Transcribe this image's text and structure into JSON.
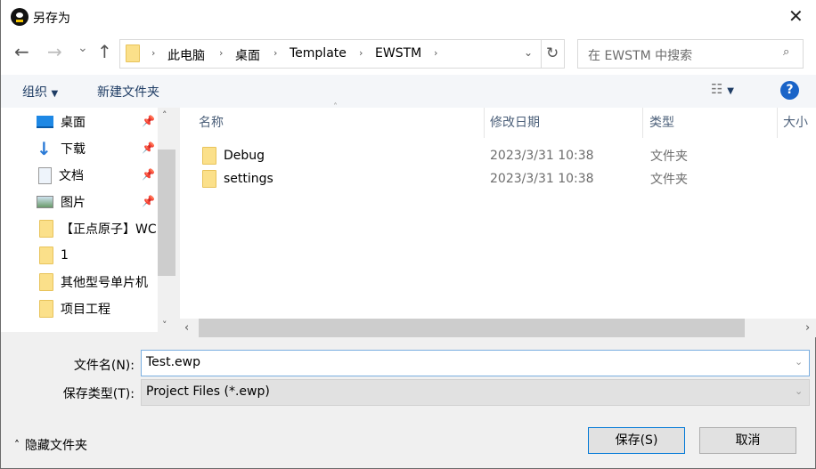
{
  "window": {
    "title": "另存为"
  },
  "nav": {
    "back": "←",
    "forward": "→",
    "recent": "⌄",
    "up": "↑",
    "breadcrumb": [
      "此电脑",
      "桌面",
      "Template",
      "EWSTM"
    ],
    "refresh": "↻",
    "search_placeholder": "在 EWSTM 中搜索"
  },
  "toolbar": {
    "organize": "组织",
    "new_folder": "新建文件夹"
  },
  "sidebar": {
    "items": [
      {
        "label": "桌面",
        "icon": "desktop-icon",
        "pinned": true
      },
      {
        "label": "下载",
        "icon": "download-icon",
        "pinned": true
      },
      {
        "label": "文档",
        "icon": "document-icon",
        "pinned": true
      },
      {
        "label": "图片",
        "icon": "pictures-icon",
        "pinned": true
      },
      {
        "label": "【正点原子】WC",
        "icon": "folder-icon"
      },
      {
        "label": "1",
        "icon": "folder-icon"
      },
      {
        "label": "其他型号单片机",
        "icon": "folder-icon"
      },
      {
        "label": "项目工程",
        "icon": "folder-icon"
      }
    ]
  },
  "list": {
    "columns": [
      "名称",
      "修改日期",
      "类型",
      "大小"
    ],
    "rows": [
      {
        "name": "Debug",
        "date": "2023/3/31 10:38",
        "type": "文件夹"
      },
      {
        "name": "settings",
        "date": "2023/3/31 10:38",
        "type": "文件夹"
      }
    ]
  },
  "form": {
    "filename_label": "文件名(N):",
    "filename_value": "Test.ewp",
    "filetype_label": "保存类型(T):",
    "filetype_value": "Project Files (*.ewp)"
  },
  "footer": {
    "hide_folders": "隐藏文件夹",
    "save": "保存(S)",
    "cancel": "取消"
  },
  "colors": {
    "accent": "#0078d7",
    "help": "#1a64c8",
    "folder": "#fbe08a"
  }
}
